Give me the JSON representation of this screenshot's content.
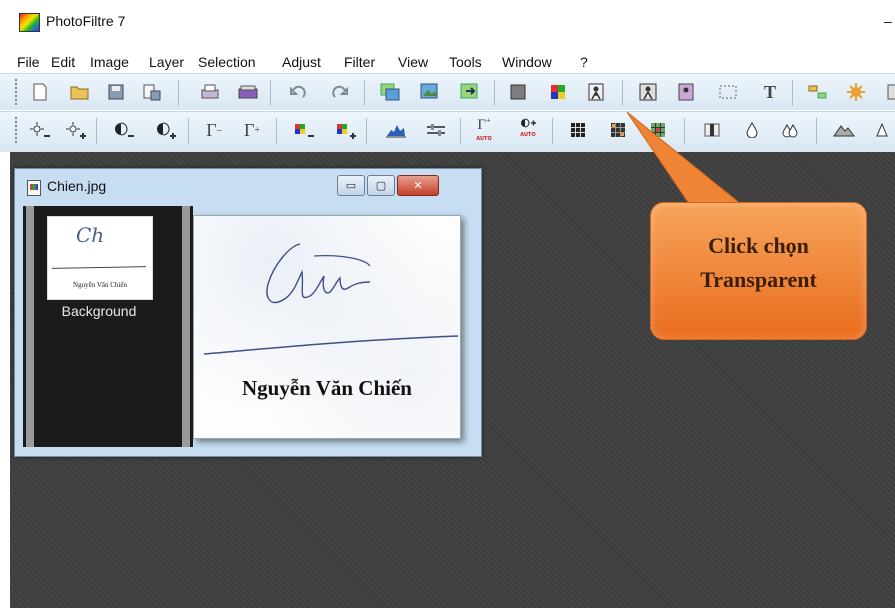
{
  "app": {
    "title": "PhotoFiltre 7",
    "window_control": "–"
  },
  "menu": [
    "File",
    "Edit",
    "Image",
    "Layer",
    "Selection",
    "Adjust",
    "Filter",
    "View",
    "Tools",
    "Window",
    "?"
  ],
  "toolbar1_icons": [
    "new-icon",
    "open-icon",
    "save-icon",
    "save-special-icon",
    "print-icon",
    "scan-icon",
    "undo-icon",
    "redo-icon",
    "duplicate-icon",
    "paste-layer-icon",
    "export-icon",
    "gray-square-icon",
    "color-palette-icon",
    "transparent-color-icon",
    "transparent-icon",
    "frame-icon",
    "selection-icon",
    "text-icon",
    "layers-icon",
    "effects-icon",
    "extra-icon"
  ],
  "toolbar2_icons": [
    "brightness-minus-icon",
    "brightness-plus-icon",
    "contrast-minus-icon",
    "contrast-plus-icon",
    "gamma-minus-icon",
    "gamma-plus-icon",
    "saturation-minus-icon",
    "saturation-plus-icon",
    "histogram-icon",
    "curves-icon",
    "auto-level-icon",
    "auto-contrast-icon",
    "mosaic-icon",
    "mosaic-dark-icon",
    "mosaic-color-icon",
    "blur-icon",
    "drop-icon",
    "drops-icon",
    "mountain-icon",
    "sharpen-icon"
  ],
  "toolbar2_auto_label": "AUTO",
  "document": {
    "title": "Chien.jpg",
    "layer_label": "Background",
    "thumb_name": "Nguyễn Văn Chiến",
    "image_name": "Nguyễn Văn Chiến",
    "controls": {
      "minimize": "▭",
      "maximize": "▢",
      "close": "✕"
    }
  },
  "callout": {
    "line1": "Click chọn",
    "line2": "Transparent"
  },
  "colors": {
    "callout": "#f08a3c",
    "workspace": "#3f3f3f",
    "toolbar": "#dde9f4"
  }
}
